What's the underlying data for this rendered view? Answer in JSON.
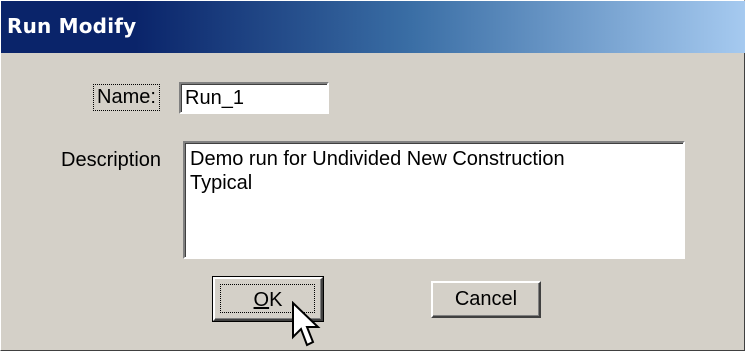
{
  "window": {
    "title": "Run Modify"
  },
  "form": {
    "name_label": "Name:",
    "name_value": "Run_1",
    "description_label": "Description",
    "description_value": "Demo run for Undivided New Construction\nTypical"
  },
  "buttons": {
    "ok_mnemonic": "O",
    "ok_rest": "K",
    "cancel_label": "Cancel"
  },
  "icons": {
    "pointer": "arrow-cursor-icon"
  },
  "colors": {
    "titlebar_start": "#0a246a",
    "titlebar_end": "#a6caf0",
    "dialog_face": "#d4d0c8"
  }
}
